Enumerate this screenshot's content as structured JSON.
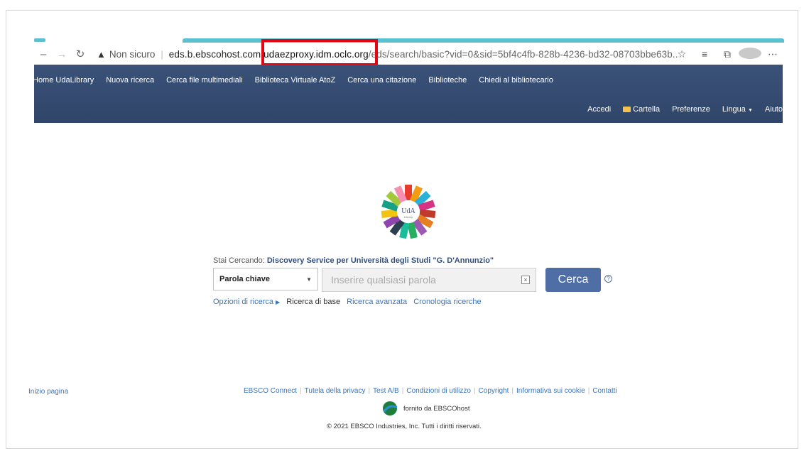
{
  "browser": {
    "back_icon": "back-icon",
    "forward_icon": "forward-icon",
    "reload_icon": "reload-icon",
    "not_secure_label": "Non sicuro",
    "url_host": "eds.b.ebscohost.com.",
    "url_proxy": "udaezproxy.idm.oclc.org",
    "url_rest": "/eds/search/basic?vid=0&sid=5bf4c4fb-828b-4236-bd32-08703bbe63b...",
    "highlight_color": "#e30613",
    "accent_color": "#5bc0cf"
  },
  "topnav": {
    "items": [
      "Home UdaLibrary",
      "Nuova ricerca",
      "Cerca file multimediali",
      "Biblioteca Virtuale AtoZ",
      "Cerca una citazione",
      "Biblioteche",
      "Chiedi al bibliotecario"
    ]
  },
  "usernav": {
    "accedi": "Accedi",
    "cartella": "Cartella",
    "preferenze": "Preferenze",
    "lingua": "Lingua",
    "aiuto": "Aiuto"
  },
  "logo": {
    "text": "UdA",
    "subtext": "Library"
  },
  "search": {
    "searching_label": "Stai Cercando:",
    "searching_target": "Discovery Service per Università degli Studi \"G. D'Annunzio\"",
    "field_selected": "Parola chiave",
    "placeholder": "Inserire qualsiasi parola",
    "button_label": "Cerca",
    "options_link": "Opzioni di ricerca",
    "basic_label": "Ricerca di base",
    "advanced_link": "Ricerca avanzata",
    "history_link": "Cronologia ricerche",
    "button_color": "#4e6ea5"
  },
  "footer": {
    "top_link": "Inizio pagina",
    "links": [
      "EBSCO Connect",
      "Tutela della privacy",
      "Test A/B",
      "Condizioni di utilizzo",
      "Copyright",
      "Informativa sui cookie",
      "Contatti"
    ],
    "powered_by": "fornito da EBSCOhost",
    "copyright": "© 2021 EBSCO Industries, Inc. Tutti i diritti riservati."
  },
  "header_color": "#344b72"
}
